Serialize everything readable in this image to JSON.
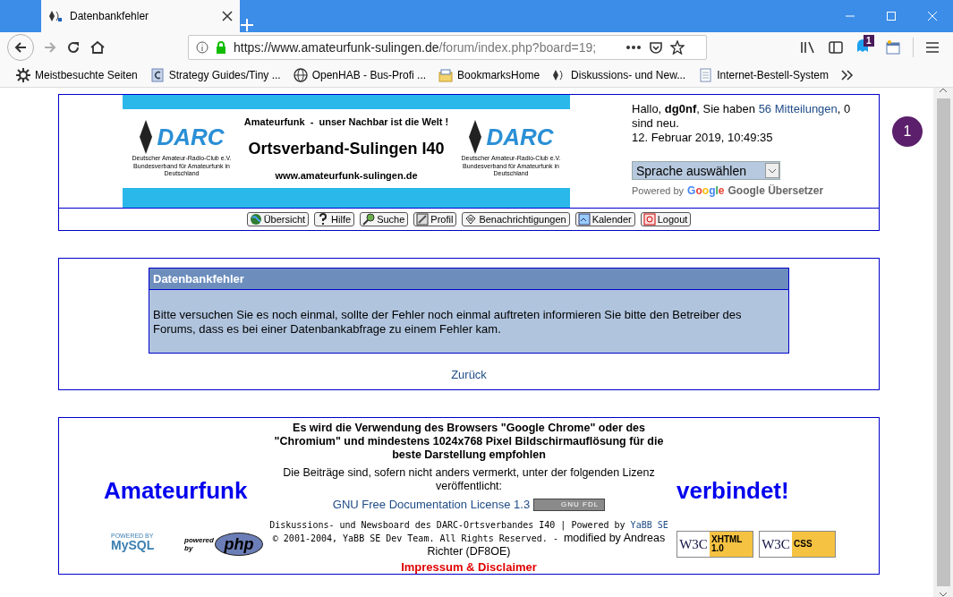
{
  "browser": {
    "tab": {
      "title": "Datenbankfehler"
    },
    "url_host": "https://www.amateurfunk-sulingen.de",
    "url_path": "/forum/index.php?board=19;",
    "extension_badge": "1",
    "bookmarks": [
      {
        "kind": "gear",
        "label": "Meistbesuchte Seiten"
      },
      {
        "kind": "page",
        "label": "Strategy Guides/Tiny ..."
      },
      {
        "kind": "globe",
        "label": "OpenHAB - Bus-Profi ..."
      },
      {
        "kind": "folder",
        "label": "BookmarksHome"
      },
      {
        "kind": "darc",
        "label": "Diskussions- und New..."
      },
      {
        "kind": "doc",
        "label": "Internet-Bestell-System"
      }
    ]
  },
  "header": {
    "banner": {
      "motto": "Amateurfunk  -  unser Nachbar ist die Welt !",
      "title": "Ortsverband-Sulingen I40",
      "website": "www.amateurfunk-sulingen.de",
      "logos": [
        {
          "logo_text": "DARC",
          "club": "Deutscher Amateur-Radio-Club e.V.",
          "club_sub": "Bundesverband für Amateurfunk in Deutschland"
        },
        {
          "logo_text": "DARC",
          "club": "Deutscher Amateur-Radio-Club e.V.",
          "club_sub": "Bundesverband für Amateurfunk in Deutschland"
        }
      ]
    },
    "greeting": "Hallo, **dg0nf**, Sie haben",
    "messages_link": "56 Mitteilungen",
    "greeting_end": ", 0 sind neu.",
    "datetime": "12. Februar 2019, 10:49:35",
    "language_select": "Sprache auswählen",
    "powered_by": "Powered by",
    "google": "Google",
    "translator": "Google Übersetzer"
  },
  "nav": [
    {
      "kind": "globe",
      "label": "Übersicht"
    },
    {
      "kind": "help",
      "label": "Hilfe"
    },
    {
      "kind": "search",
      "label": "Suche"
    },
    {
      "kind": "profile",
      "label": "Profil"
    },
    {
      "kind": "notify",
      "label": "Benachrichtigungen"
    },
    {
      "kind": "calendar",
      "label": "Kalender"
    },
    {
      "kind": "logout",
      "label": "Logout"
    }
  ],
  "error": {
    "title": "Datenbankfehler",
    "message": "Bitte versuchen Sie es noch einmal, sollte der Fehler noch einmal auftreten informieren Sie bitte den Betreiber des Forums, dass es bei einer Datenbankabfrage zu einem Fehler kam.",
    "back_link": "Zurück"
  },
  "footer": {
    "slogan_left": "Amateurfunk",
    "slogan_right": "verbindet!",
    "browser_hint": "Es wird die Verwendung des Browsers \"Google Chrome\" oder des \"Chromium\" und mindestens 1024x768 Pixel Bildschirmauflösung für die beste Darstellung empfohlen",
    "license_text": "Die Beiträge sind, sofern nicht anders vermerkt, unter der folgenden Lizenz veröffentlicht:",
    "license_link": "GNU Free Documentation License 1.3",
    "fdl_badge": "GNU FDL",
    "credits": "Diskussions- und Newsboard des DARC-Ortsverbandes I40 | Powered by",
    "yabb_link": "YaBB SE",
    "copyright": "© 2001-2004, YaBB SE Dev Team. All Rights Reserved. -",
    "modified": "modified by Andreas Richter (DF8OE)",
    "impressum": "Impressum & Disclaimer",
    "mysql_badge": {
      "top": "POWERED BY",
      "main": "MySQL"
    },
    "php_badge": {
      "top": "powered by",
      "main": "php"
    },
    "w3c_badges": [
      {
        "org": "W3C",
        "label": "XHTML 1.0"
      },
      {
        "org": "W3C",
        "label": "CSS"
      }
    ]
  },
  "notification_bubble": "1"
}
